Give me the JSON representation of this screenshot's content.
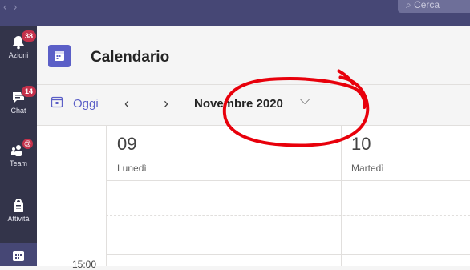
{
  "search": {
    "placeholder": "Cerca"
  },
  "rail": {
    "items": [
      {
        "label": "Azioni",
        "badge": "38"
      },
      {
        "label": "Chat",
        "badge": "14"
      },
      {
        "label": "Team",
        "badge": "@"
      },
      {
        "label": "Attività"
      }
    ]
  },
  "header": {
    "title": "Calendario"
  },
  "toolbar": {
    "today": "Oggi",
    "month": "Novembre 2020"
  },
  "days": [
    {
      "date": "09",
      "name": "Lunedì"
    },
    {
      "date": "10",
      "name": "Martedì"
    }
  ],
  "time_slot": "15:00",
  "colors": {
    "rail": "#33344a",
    "topbar": "#464775",
    "accent": "#5b5fc7",
    "badge": "#c4314b",
    "annotation": "#e8000b"
  }
}
